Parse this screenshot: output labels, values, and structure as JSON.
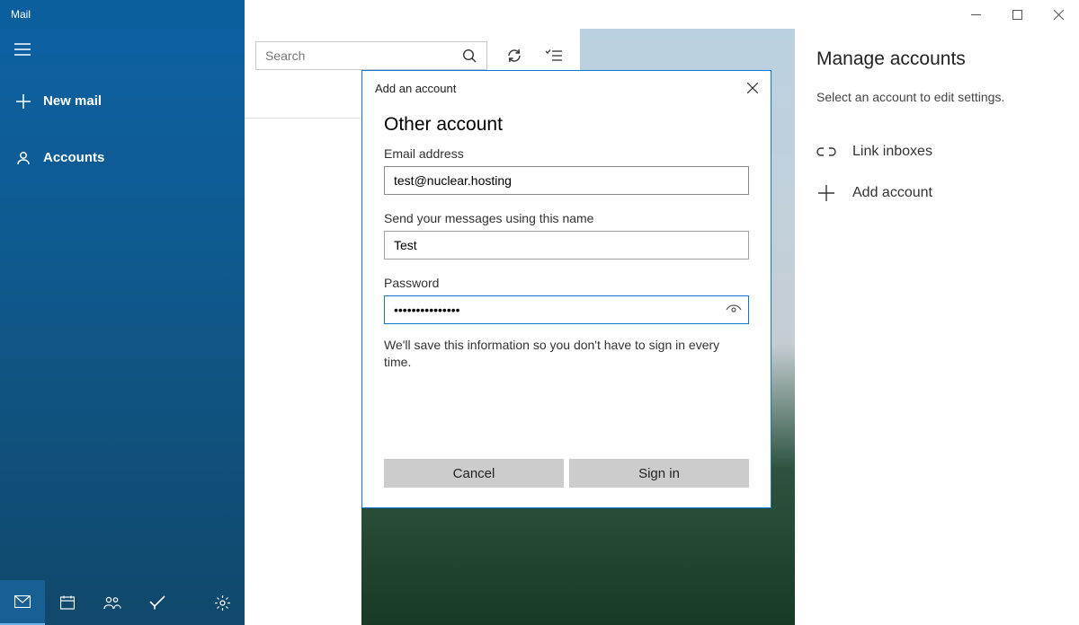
{
  "app": {
    "title": "Mail"
  },
  "sidebar": {
    "new_mail": "New mail",
    "accounts": "Accounts"
  },
  "search": {
    "placeholder": "Search"
  },
  "right": {
    "title": "Manage accounts",
    "subtitle": "Select an account to edit settings.",
    "items": [
      {
        "label": "Link inboxes"
      },
      {
        "label": "Add account"
      }
    ]
  },
  "dialog": {
    "header": "Add an account",
    "title": "Other account",
    "email_label": "Email address",
    "email_value": "test@nuclear.hosting",
    "name_label": "Send your messages using this name",
    "name_value": "Test",
    "password_label": "Password",
    "password_value": "•••••••••••••••",
    "note": "We'll save this information so you don't have to sign in every time.",
    "cancel": "Cancel",
    "signin": "Sign in"
  }
}
